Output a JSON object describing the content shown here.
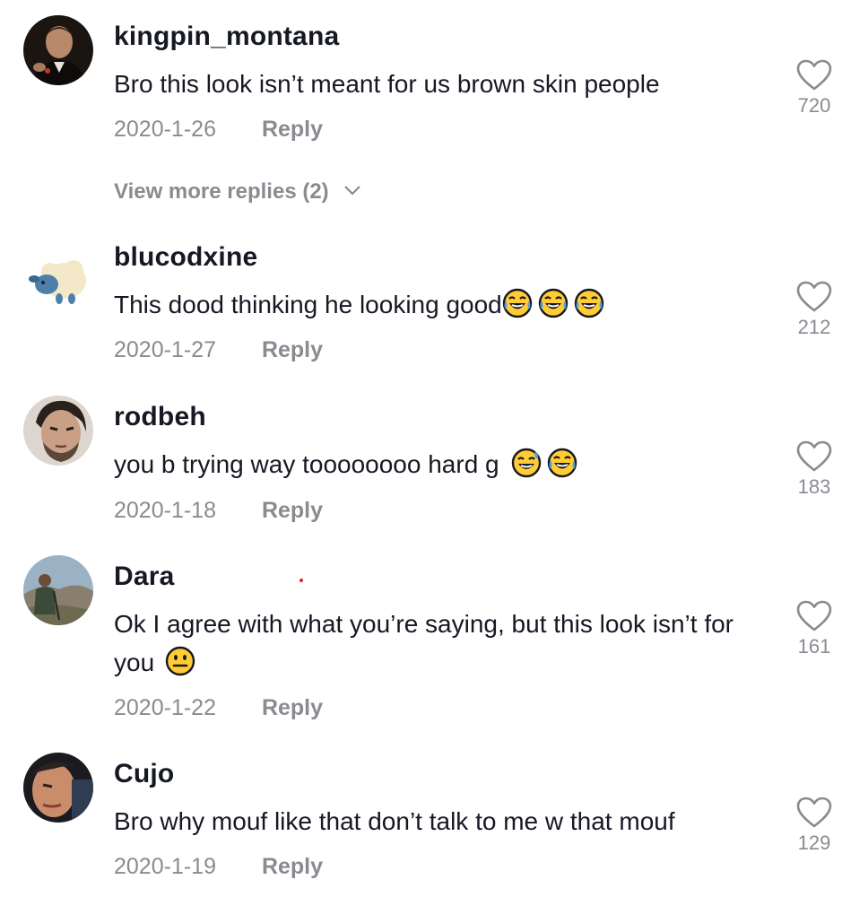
{
  "comments": [
    {
      "username": "kingpin_montana",
      "text": "Bro this look isn’t meant for us brown skin people",
      "date": "2020-1-26",
      "reply": "Reply",
      "likes": "720",
      "view_more": "View more replies (2)",
      "avatar_icon": "avatar-icon"
    },
    {
      "username": "blucodxine",
      "text": "This dood thinking he looking good",
      "emojis": [
        "joy-emoji",
        "joy-emoji",
        "joy-emoji"
      ],
      "date": "2020-1-27",
      "reply": "Reply",
      "likes": "212",
      "avatar_icon": "avatar-icon"
    },
    {
      "username": "rodbeh",
      "text": "you b trying way toooooooo hard g ",
      "emojis": [
        "sweat-smile-emoji",
        "joy-emoji"
      ],
      "date": "2020-1-18",
      "reply": "Reply",
      "likes": "183",
      "avatar_icon": "avatar-icon"
    },
    {
      "username": "Dara",
      "text": "Ok I agree with what you’re saying, but this look isn’t for you",
      "emojis": [
        "neutral-face-emoji"
      ],
      "date": "2020-1-22",
      "reply": "Reply",
      "likes": "161",
      "avatar_icon": "avatar-icon"
    },
    {
      "username": "Cujo",
      "text": "Bro why mouf like that don’t talk to me w that mouf",
      "date": "2020-1-19",
      "reply": "Reply",
      "likes": "129",
      "avatar_icon": "avatar-icon"
    }
  ],
  "colors": {
    "text": "#161823",
    "muted": "#8a8b91",
    "emoji_yellow": "#ffcc33",
    "emoji_outline": "#161823"
  }
}
